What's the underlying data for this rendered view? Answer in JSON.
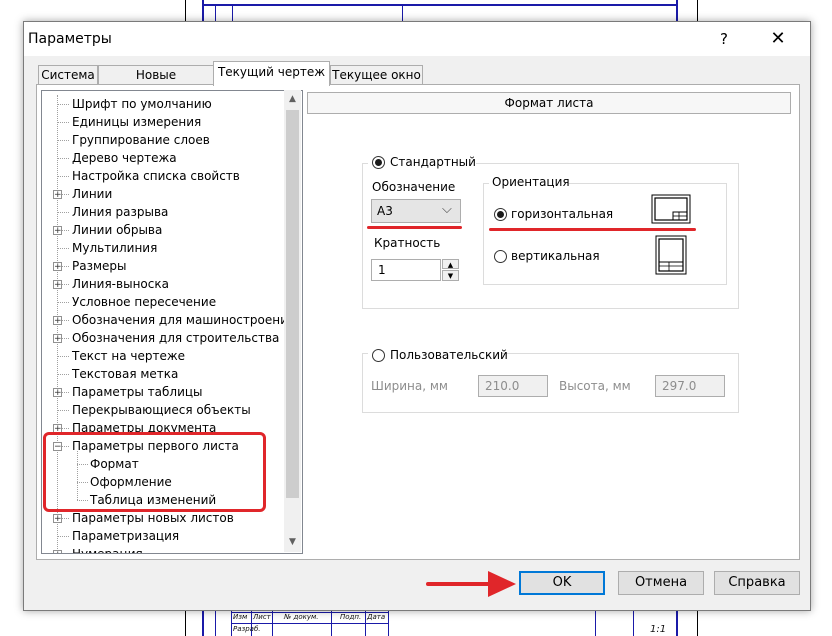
{
  "window": {
    "title": "Параметры",
    "help_glyph": "?",
    "close_glyph": "✕"
  },
  "tabs": [
    {
      "label": "Система",
      "active": false
    },
    {
      "label": "Новые документы",
      "active": false
    },
    {
      "label": "Текущий чертеж",
      "active": true
    },
    {
      "label": "Текущее окно",
      "active": false
    }
  ],
  "tree": {
    "items": [
      {
        "label": "Шрифт по умолчанию",
        "expandable": false
      },
      {
        "label": "Единицы измерения",
        "expandable": false
      },
      {
        "label": "Группирование слоев",
        "expandable": false
      },
      {
        "label": "Дерево чертежа",
        "expandable": false
      },
      {
        "label": "Настройка списка свойств",
        "expandable": false
      },
      {
        "label": "Линии",
        "expandable": true
      },
      {
        "label": "Линия разрыва",
        "expandable": false
      },
      {
        "label": "Линии обрыва",
        "expandable": true
      },
      {
        "label": "Мультилиния",
        "expandable": false
      },
      {
        "label": "Размеры",
        "expandable": true
      },
      {
        "label": "Линия-выноска",
        "expandable": true
      },
      {
        "label": "Условное пересечение",
        "expandable": false
      },
      {
        "label": "Обозначения для машиностроения",
        "expandable": true
      },
      {
        "label": "Обозначения для строительства",
        "expandable": true
      },
      {
        "label": "Текст на чертеже",
        "expandable": false
      },
      {
        "label": "Текстовая метка",
        "expandable": false
      },
      {
        "label": "Параметры таблицы",
        "expandable": true
      },
      {
        "label": "Перекрывающиеся объекты",
        "expandable": false
      },
      {
        "label": "Параметры документа",
        "expandable": true
      },
      {
        "label": "Параметры первого листа",
        "expandable": true,
        "expanded": true
      },
      {
        "label": "Формат",
        "child": true,
        "selected": true
      },
      {
        "label": "Оформление",
        "child": true
      },
      {
        "label": "Таблица изменений",
        "child": true
      },
      {
        "label": "Параметры новых листов",
        "expandable": true
      },
      {
        "label": "Параметризация",
        "expandable": false
      },
      {
        "label": "Нумерация",
        "expandable": true
      }
    ]
  },
  "format_panel": {
    "header": "Формат листа",
    "standard": {
      "label": "Стандартный",
      "selected": true,
      "designation_label": "Обозначение",
      "designation_value": "А3",
      "multiplicity_label": "Кратность",
      "multiplicity_value": "1",
      "orientation": {
        "label": "Ориентация",
        "horizontal_label": "горизонтальная",
        "vertical_label": "вертикальная",
        "selected": "horizontal"
      }
    },
    "custom": {
      "label": "Пользовательский",
      "selected": false,
      "width_label": "Ширина, мм",
      "width_value": "210.0",
      "height_label": "Высота, мм",
      "height_value": "297.0"
    }
  },
  "buttons": {
    "ok": "OK",
    "cancel": "Отмена",
    "help": "Справка"
  },
  "background_drawing": {
    "stamp_cells": [
      "Изм",
      "Лист",
      "№ докум.",
      "Подп.",
      "Дата",
      "Разраб."
    ],
    "scale": "1:1"
  },
  "annotations": {
    "highlight_color": "#e0262a"
  }
}
